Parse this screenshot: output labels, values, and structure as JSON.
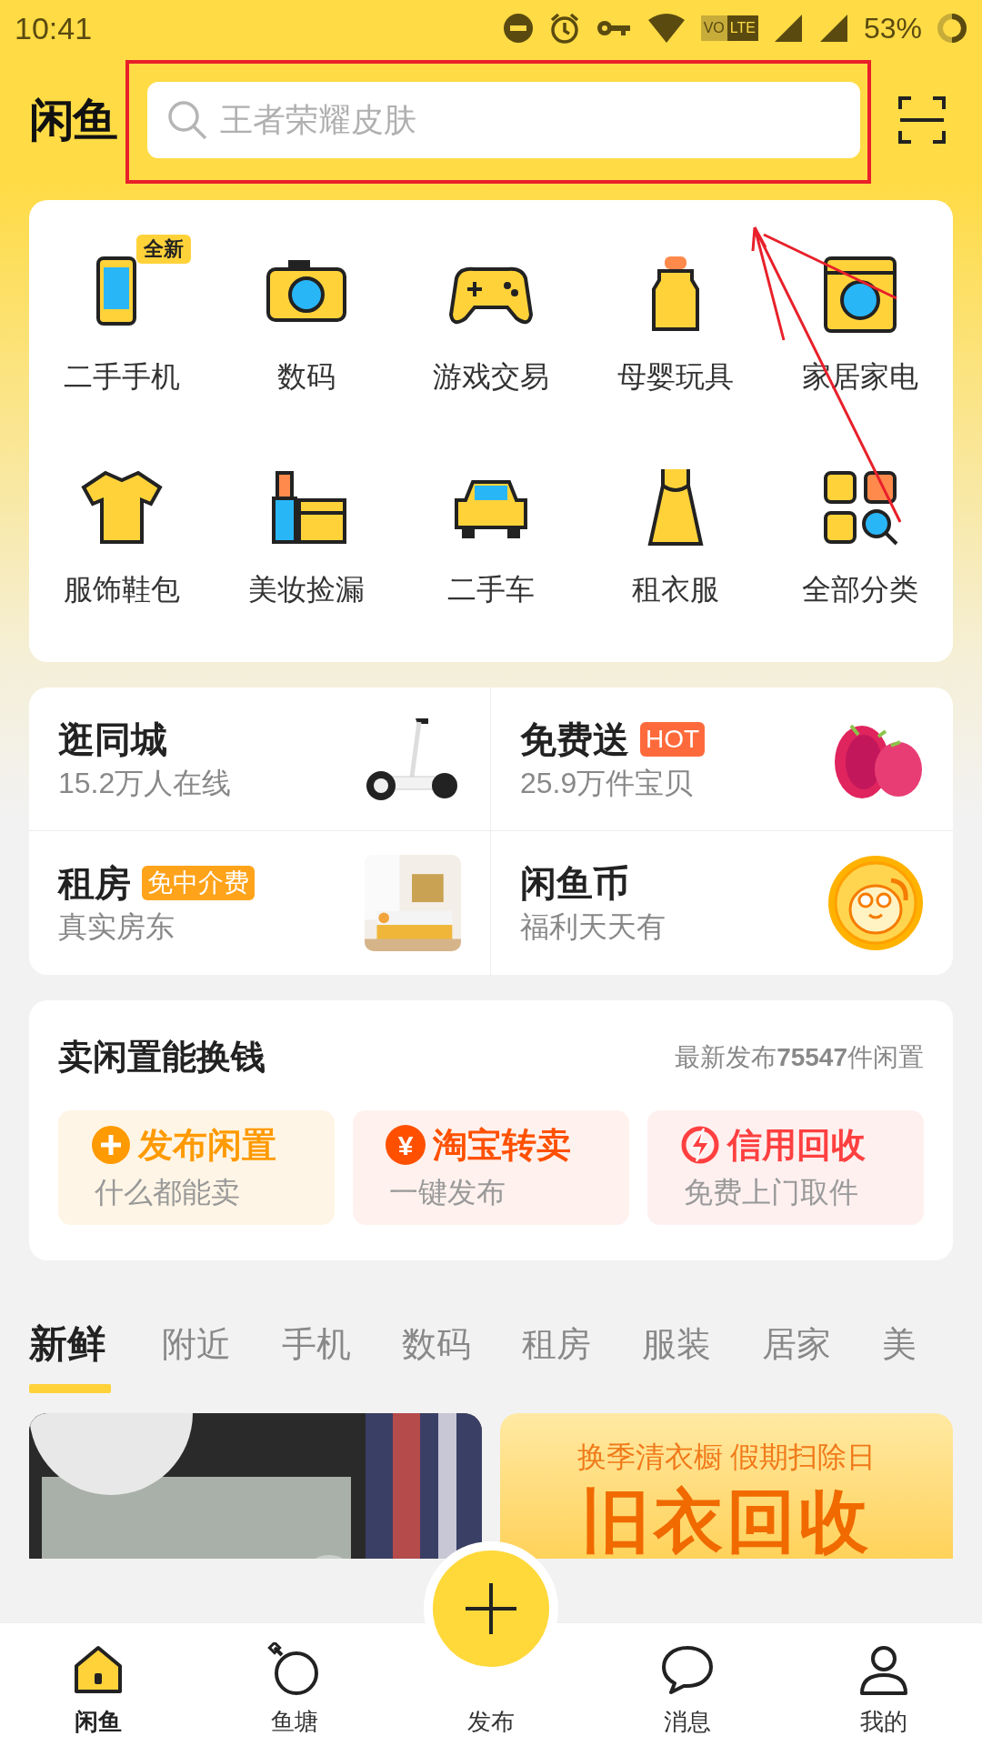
{
  "status_bar": {
    "time": "10:41",
    "volte": [
      "VO",
      "LTE"
    ],
    "battery": "53%"
  },
  "header": {
    "logo": "闲鱼",
    "search": {
      "placeholder": "王者荣耀皮肤"
    }
  },
  "categories": [
    {
      "label": "二手手机",
      "badge": "全新"
    },
    {
      "label": "数码"
    },
    {
      "label": "游戏交易"
    },
    {
      "label": "母婴玩具"
    },
    {
      "label": "家居家电"
    },
    {
      "label": "服饰鞋包"
    },
    {
      "label": "美妆捡漏"
    },
    {
      "label": "二手车"
    },
    {
      "label": "租衣服"
    },
    {
      "label": "全部分类"
    }
  ],
  "features": [
    {
      "title": "逛同城",
      "subtitle": "15.2万人在线",
      "kind": "scooter"
    },
    {
      "title": "免费送",
      "tag": {
        "text": "HOT",
        "color": "#ff6a3c"
      },
      "subtitle": "25.9万件宝贝",
      "kind": "fruit"
    },
    {
      "title": "租房",
      "tag": {
        "text": "免中介费",
        "color": "#ffa31a"
      },
      "subtitle": "真实房东",
      "kind": "room"
    },
    {
      "title": "闲鱼币",
      "subtitle": "福利天天有",
      "kind": "coin"
    }
  ],
  "sell": {
    "title": "卖闲置能换钱",
    "stat": "最新发布**75547**件闲置",
    "actions": [
      {
        "title": "发布闲置",
        "subtitle": "什么都能卖",
        "kind": "plus",
        "color": "#ff9a00"
      },
      {
        "title": "淘宝转卖",
        "subtitle": "一键发布",
        "kind": "yen",
        "icon_char": "¥",
        "color": "#ff5000"
      },
      {
        "title": "信用回收",
        "subtitle": "免费上门取件",
        "kind": "bolt",
        "color": "#ff4040"
      }
    ]
  },
  "tabs": [
    {
      "label": "新鲜",
      "selected": true
    },
    {
      "label": "附近",
      "selected": false
    },
    {
      "label": "手机",
      "selected": false
    },
    {
      "label": "数码",
      "selected": false
    },
    {
      "label": "租房",
      "selected": false
    },
    {
      "label": "服装",
      "selected": false
    },
    {
      "label": "居家",
      "selected": false
    },
    {
      "label": "美",
      "selected": false
    }
  ],
  "feed": [
    {
      "kind": "picture"
    },
    {
      "kind": "banner",
      "lines": [
        "换季清衣橱 假期扫除日",
        "旧衣回收"
      ]
    }
  ],
  "nav": [
    {
      "label": "闲鱼",
      "selected": true,
      "kind": "home"
    },
    {
      "label": "鱼塘",
      "selected": false,
      "kind": "pond"
    },
    {
      "label": "发布",
      "selected": false,
      "kind": "publish"
    },
    {
      "label": "消息",
      "selected": false,
      "kind": "message"
    },
    {
      "label": "我的",
      "selected": false,
      "kind": "me"
    }
  ]
}
